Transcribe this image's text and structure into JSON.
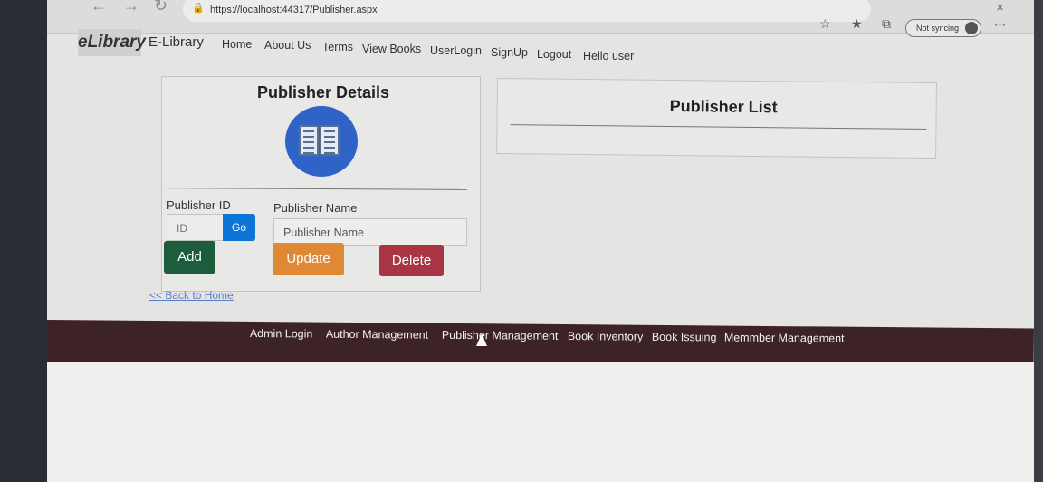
{
  "browser": {
    "url": "https://localhost:44317/Publisher.aspx",
    "sync_label": "Not syncing"
  },
  "nav": {
    "brand_logo": "eLibrary",
    "brand_text": "E-Library",
    "links": [
      "Home",
      "About Us",
      "Terms",
      "View Books",
      "UserLogin",
      "SignUp",
      "Logout",
      "Hello user"
    ]
  },
  "details": {
    "title": "Publisher Details",
    "id_label": "Publisher ID",
    "id_placeholder": "ID",
    "go_label": "Go",
    "name_label": "Publisher Name",
    "name_placeholder": "Publisher Name",
    "add_label": "Add",
    "update_label": "Update",
    "delete_label": "Delete"
  },
  "back_link": "<< Back to Home",
  "list": {
    "title": "Publisher List"
  },
  "footer": {
    "links": [
      "Admin Login",
      "Author Management",
      "Publisher Management",
      "Book Inventory",
      "Book Issuing",
      "Memmber Management"
    ]
  },
  "colors": {
    "go": "#0d74d8",
    "add": "#1e5d3c",
    "update": "#df8935",
    "delete": "#a83544",
    "footer": "#3d2228",
    "icon": "#2f63c6"
  }
}
